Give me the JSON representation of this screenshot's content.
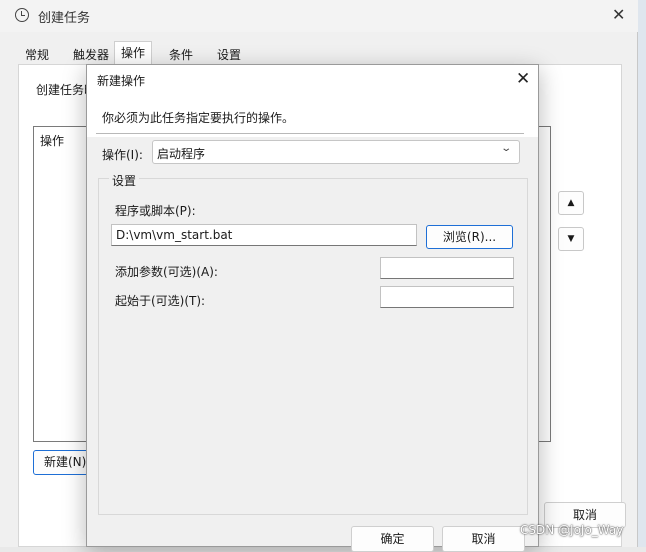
{
  "parent_window": {
    "title": "创建任务",
    "close_glyph": "✕",
    "tabs": [
      "常规",
      "触发器",
      "操作",
      "条件",
      "设置"
    ],
    "active_tab": "操作",
    "description": "创建任务时",
    "list_header": "操作",
    "new_button": "新建(N)",
    "move_up_glyph": "▲",
    "move_down_glyph": "▼",
    "cancel_button": "取消"
  },
  "dialog": {
    "title": "新建操作",
    "close_glyph": "✕",
    "instruction": "你必须为此任务指定要执行的操作。",
    "action_label": "操作(I):",
    "action_value": "启动程序",
    "settings_group_label": "设置",
    "program_label": "程序或脚本(P):",
    "program_value": "D:\\vm\\vm_start.bat",
    "browse_button": "浏览(R)...",
    "args_label": "添加参数(可选)(A):",
    "args_value": "",
    "start_in_label": "起始于(可选)(T):",
    "start_in_value": "",
    "ok_button": "确定",
    "cancel_button": "取消"
  },
  "watermark": "CSDN @JoJo_Way",
  "icons": [
    "clock-icon",
    "close-icon",
    "chevron-down-icon",
    "arrow-up-icon",
    "arrow-down-icon"
  ]
}
